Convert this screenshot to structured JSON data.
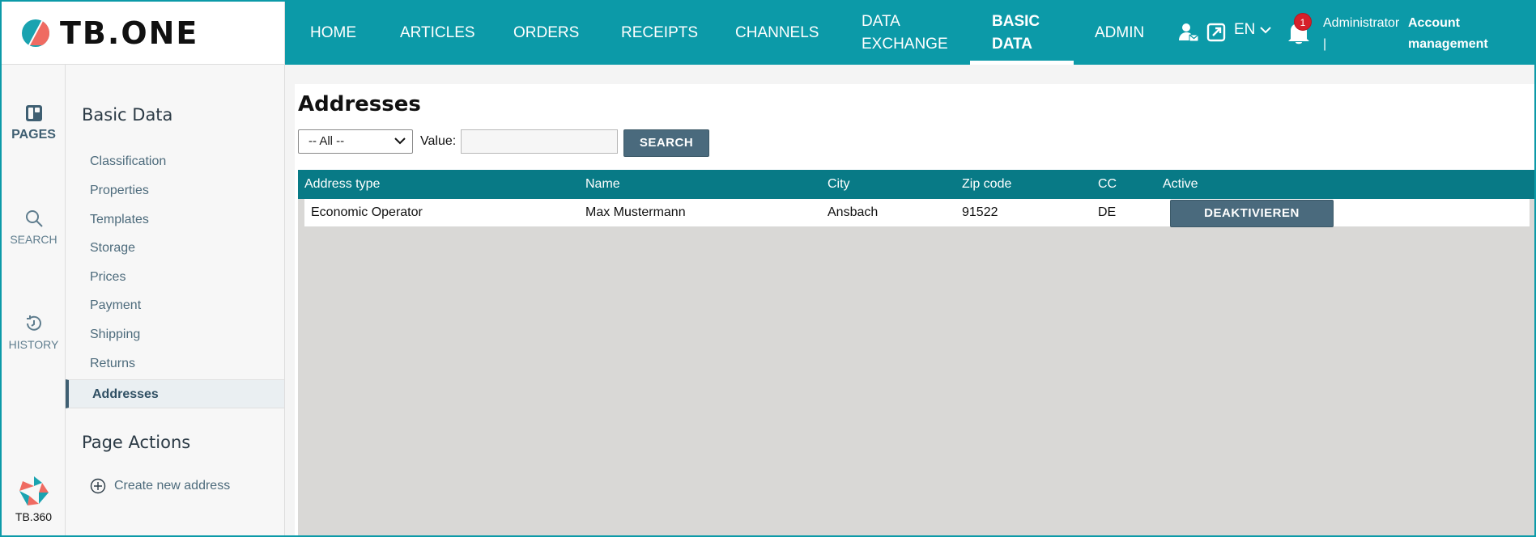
{
  "app": {
    "logo_text": "TB.ONE"
  },
  "topnav": {
    "items": [
      {
        "label": "HOME"
      },
      {
        "label": "ARTICLES"
      },
      {
        "label": "ORDERS"
      },
      {
        "label": "RECEIPTS"
      },
      {
        "label": "CHANNELS"
      },
      {
        "label_line1": "DATA",
        "label_line2": "EXCHANGE"
      },
      {
        "label_line1": "BASIC",
        "label_line2": "DATA",
        "active": true
      },
      {
        "label": "ADMIN"
      }
    ],
    "language": "EN",
    "notification_count": "1",
    "user_name": "Administrator",
    "user_separator": "|",
    "account_line1": "Account",
    "account_line2": "management"
  },
  "rail": {
    "pages_label": "PAGES",
    "search_label": "SEARCH",
    "history_label": "HISTORY",
    "brand_label": "TB.360"
  },
  "sidebar": {
    "heading": "Basic Data",
    "items": [
      {
        "label": "Classification"
      },
      {
        "label": "Properties"
      },
      {
        "label": "Templates"
      },
      {
        "label": "Storage"
      },
      {
        "label": "Prices"
      },
      {
        "label": "Payment"
      },
      {
        "label": "Shipping"
      },
      {
        "label": "Returns"
      },
      {
        "label": "Addresses",
        "active": true
      }
    ],
    "actions_heading": "Page Actions",
    "create_label": "Create new address"
  },
  "main": {
    "title": "Addresses",
    "filter": {
      "selected": "-- All --",
      "value_label": "Value:",
      "value": ""
    },
    "search_button": "SEARCH",
    "table": {
      "columns": [
        "Address type",
        "Name",
        "City",
        "Zip code",
        "CC",
        "Active"
      ],
      "rows": [
        {
          "address_type": "Economic Operator",
          "name": "Max Mustermann",
          "city": "Ansbach",
          "zip": "91522",
          "cc": "DE",
          "action": "DEAKTIVIEREN"
        }
      ]
    }
  },
  "colors": {
    "brand_teal": "#0c9aa8",
    "header_teal": "#087a86",
    "button_slate": "#4a6a7d",
    "badge_red": "#d6202a"
  }
}
